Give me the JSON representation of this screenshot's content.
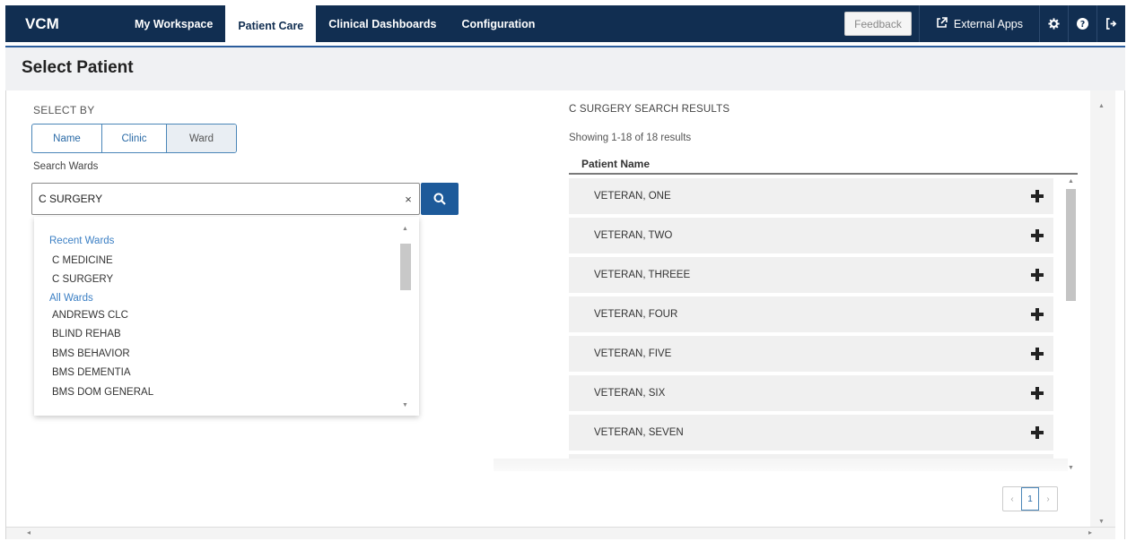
{
  "nav": {
    "brand": "VCM",
    "tabs": [
      {
        "label": "My Workspace"
      },
      {
        "label": "Patient Care"
      },
      {
        "label": "Clinical Dashboards"
      },
      {
        "label": "Configuration"
      }
    ],
    "active_tab": "Patient Care",
    "feedback_label": "Feedback",
    "external_apps_label": "External Apps",
    "accent_color": "#112e51"
  },
  "page": {
    "title": "Select Patient"
  },
  "left": {
    "select_by_label": "SELECT BY",
    "segments": [
      "Name",
      "Clinic",
      "Ward"
    ],
    "selected_segment": "Ward",
    "search_label": "Search Wards",
    "search_value": "C SURGERY",
    "dropdown": {
      "recent_label": "Recent Wards",
      "recent": [
        "C MEDICINE",
        "C SURGERY"
      ],
      "all_label": "All Wards",
      "all": [
        "ANDREWS CLC",
        "BLIND REHAB",
        "BMS BEHAVIOR",
        "BMS DEMENTIA",
        "BMS DOM GENERAL"
      ]
    }
  },
  "right": {
    "results_title": "C SURGERY SEARCH RESULTS",
    "results_count": "Showing 1-18 of 18 results",
    "column_header": "Patient Name",
    "patients": [
      "VETERAN, ONE",
      "VETERAN, TWO",
      "VETERAN, THREEE",
      "VETERAN, FOUR",
      "VETERAN, FIVE",
      "VETERAN, SIX",
      "VETERAN, SEVEN"
    ],
    "pager": {
      "prev": "‹",
      "current": "1",
      "next": "›"
    }
  }
}
